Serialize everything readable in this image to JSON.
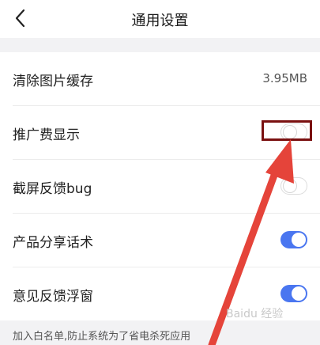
{
  "header": {
    "title": "通用设置",
    "back_icon": "chevron-left-icon"
  },
  "rows": [
    {
      "label": "清除图片缓存",
      "value": "3.95MB"
    },
    {
      "label": "推广费显示",
      "toggle": "off"
    },
    {
      "label": "截屏反馈bug",
      "toggle": "off"
    },
    {
      "label": "产品分享话术",
      "toggle": "on"
    },
    {
      "label": "意见反馈浮窗",
      "toggle": "on"
    }
  ],
  "footer": {
    "note": "加入白名单,防止系统为了省电杀死应用"
  },
  "annotation": {
    "highlight_color": "#7a1010",
    "arrow_color": "#e5443a"
  },
  "watermark": {
    "text": "Baidu 经验"
  },
  "colors": {
    "toggle_on": "#4a76f0",
    "background": "#f2f2f4"
  }
}
